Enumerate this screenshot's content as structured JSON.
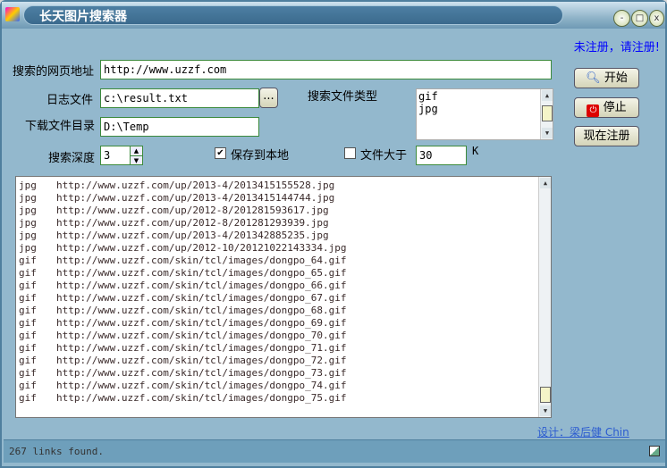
{
  "window": {
    "title": "长天图片搜索器",
    "min": "-",
    "max": "□",
    "close": "x"
  },
  "register_notice": "未注册，请注册!",
  "form": {
    "url_label": "搜索的网页地址",
    "url_value": "http://www.uzzf.com",
    "log_label": "日志文件",
    "log_value": "c:\\result.txt",
    "browse": "...",
    "dir_label": "下载文件目录",
    "dir_value": "D:\\Temp",
    "types_label": "搜索文件类型",
    "types": [
      "gif",
      "jpg"
    ],
    "depth_label": "搜索深度",
    "depth_value": "3",
    "save_label": "保存到本地",
    "save_checked": true,
    "size_label": "文件大于",
    "size_checked": false,
    "size_value": "30",
    "size_unit": "K"
  },
  "buttons": {
    "start": "开始",
    "stop": "停止",
    "register": "现在注册"
  },
  "results": [
    [
      "jpg",
      "http://www.uzzf.com/up/2013-4/2013415155528.jpg"
    ],
    [
      "jpg",
      "http://www.uzzf.com/up/2013-4/2013415144744.jpg"
    ],
    [
      "jpg",
      "http://www.uzzf.com/up/2012-8/201281593617.jpg"
    ],
    [
      "jpg",
      "http://www.uzzf.com/up/2012-8/201281293939.jpg"
    ],
    [
      "jpg",
      "http://www.uzzf.com/up/2013-4/201342885235.jpg"
    ],
    [
      "jpg",
      "http://www.uzzf.com/up/2012-10/20121022143334.jpg"
    ],
    [
      "gif",
      "http://www.uzzf.com/skin/tcl/images/dongpo_64.gif"
    ],
    [
      "gif",
      "http://www.uzzf.com/skin/tcl/images/dongpo_65.gif"
    ],
    [
      "gif",
      "http://www.uzzf.com/skin/tcl/images/dongpo_66.gif"
    ],
    [
      "gif",
      "http://www.uzzf.com/skin/tcl/images/dongpo_67.gif"
    ],
    [
      "gif",
      "http://www.uzzf.com/skin/tcl/images/dongpo_68.gif"
    ],
    [
      "gif",
      "http://www.uzzf.com/skin/tcl/images/dongpo_69.gif"
    ],
    [
      "gif",
      "http://www.uzzf.com/skin/tcl/images/dongpo_70.gif"
    ],
    [
      "gif",
      "http://www.uzzf.com/skin/tcl/images/dongpo_71.gif"
    ],
    [
      "gif",
      "http://www.uzzf.com/skin/tcl/images/dongpo_72.gif"
    ],
    [
      "gif",
      "http://www.uzzf.com/skin/tcl/images/dongpo_73.gif"
    ],
    [
      "gif",
      "http://www.uzzf.com/skin/tcl/images/dongpo_74.gif"
    ],
    [
      "gif",
      "http://www.uzzf.com/skin/tcl/images/dongpo_75.gif"
    ]
  ],
  "design_credit": "设计：梁后健 Chin",
  "status": "267 links found."
}
